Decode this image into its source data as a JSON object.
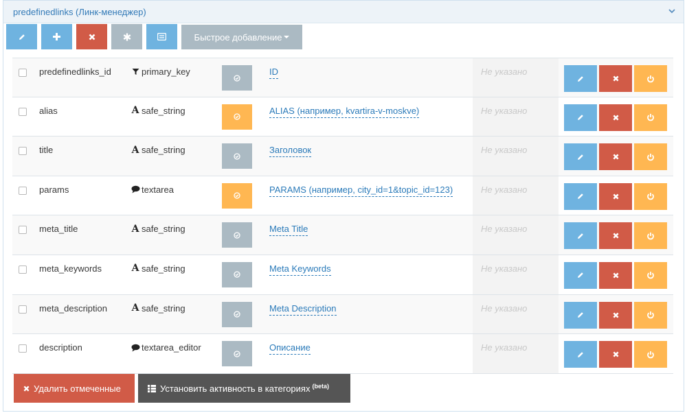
{
  "panel": {
    "title": "predefinedlinks (Линк-менеджер)"
  },
  "toolbar": {
    "buttons": [
      {
        "icon": "pencil-icon",
        "color": "#6fb3e0"
      },
      {
        "icon": "plus-icon",
        "color": "#6fb3e0"
      },
      {
        "icon": "close-icon",
        "color": "#d15b47"
      },
      {
        "icon": "asterisk-icon",
        "color": "#abbac3"
      },
      {
        "icon": "list-icon",
        "color": "#6fb3e0"
      }
    ],
    "quick_add_label": "Быстрое добавление"
  },
  "fields": [
    {
      "name": "predefinedlinks_id",
      "type_icon": "filter-icon",
      "type": "primary_key",
      "toggle": "gray",
      "label": "ID",
      "value": "Не указано"
    },
    {
      "name": "alias",
      "type_icon": "font-icon",
      "type": "safe_string",
      "toggle": "orange",
      "label": "ALIAS (например, kvartira-v-moskve)",
      "value": "Не указано"
    },
    {
      "name": "title",
      "type_icon": "font-icon",
      "type": "safe_string",
      "toggle": "gray",
      "label": "Заголовок",
      "value": "Не указано"
    },
    {
      "name": "params",
      "type_icon": "comment-icon",
      "type": "textarea",
      "toggle": "orange",
      "label": "PARAMS (например, city_id=1&topic_id=123)",
      "value": "Не указано"
    },
    {
      "name": "meta_title",
      "type_icon": "font-icon",
      "type": "safe_string",
      "toggle": "gray",
      "label": "Meta Title",
      "value": "Не указано"
    },
    {
      "name": "meta_keywords",
      "type_icon": "font-icon",
      "type": "safe_string",
      "toggle": "gray",
      "label": "Meta Keywords",
      "value": "Не указано"
    },
    {
      "name": "meta_description",
      "type_icon": "font-icon",
      "type": "safe_string",
      "toggle": "gray",
      "label": "Meta Description",
      "value": "Не указано"
    },
    {
      "name": "description",
      "type_icon": "comment-icon",
      "type": "textarea_editor",
      "toggle": "gray",
      "label": "Описание",
      "value": "Не указано"
    }
  ],
  "bottom": {
    "delete_label": "Удалить отмеченные",
    "set_activity_label": "Установить активность в категориях",
    "set_activity_badge": "(beta)"
  },
  "colors": {
    "blue": "#6fb3e0",
    "red": "#d15b47",
    "orange": "#ffb752",
    "gray": "#abbac3",
    "link": "#2a7ab9"
  }
}
